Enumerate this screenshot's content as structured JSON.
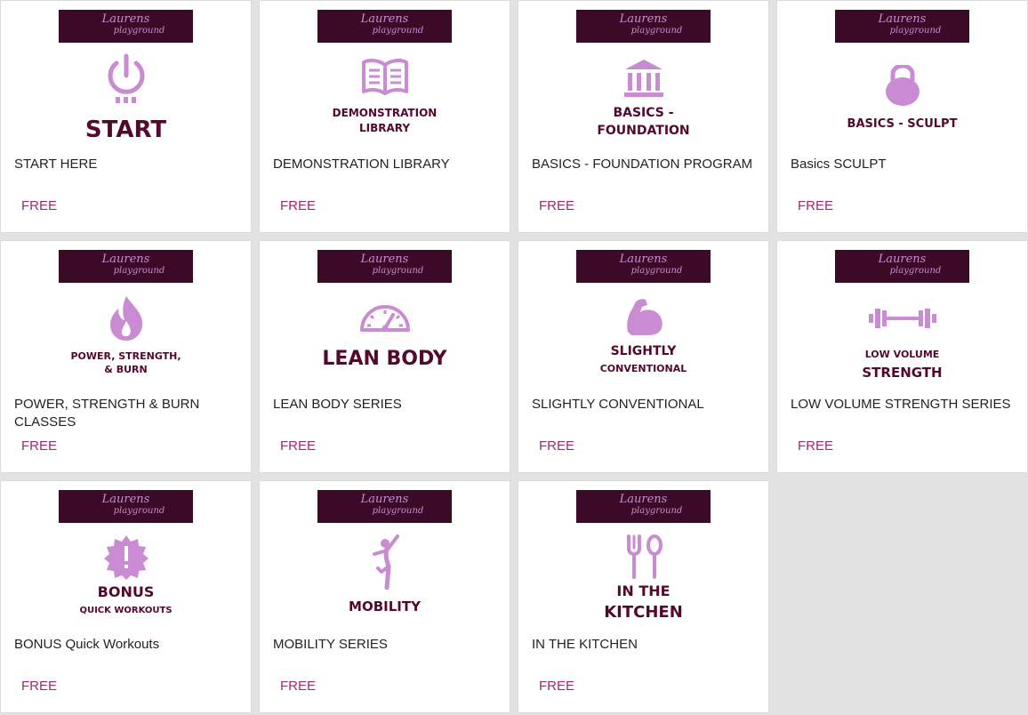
{
  "brand": {
    "line1": "Laurens",
    "line2": "playground"
  },
  "colors": {
    "banner": "#3a0a26",
    "icon": "#c98bd1",
    "icon_text": "#54082e",
    "price": "#a12a6e"
  },
  "courses": [
    {
      "icon": "power-icon",
      "thumb_line1": "START",
      "thumb_line2": "",
      "title": "START HERE",
      "price": "FREE"
    },
    {
      "icon": "book-icon",
      "thumb_line1": "DEMONSTRATION",
      "thumb_line2": "LIBRARY",
      "title": "DEMONSTRATION LIBRARY",
      "price": "FREE"
    },
    {
      "icon": "bank-icon",
      "thumb_line1": "BASICS -",
      "thumb_line2": "FOUNDATION",
      "title": "BASICS - FOUNDATION PROGRAM",
      "price": "FREE"
    },
    {
      "icon": "kettlebell-icon",
      "thumb_line1": "BASICS - SCULPT",
      "thumb_line2": "",
      "title": "Basics SCULPT",
      "price": "FREE"
    },
    {
      "icon": "flame-icon",
      "thumb_line1": "POWER, STRENGTH,",
      "thumb_line2": "& BURN",
      "title": "POWER, STRENGTH & BURN CLASSES",
      "price": "FREE"
    },
    {
      "icon": "speedometer-icon",
      "thumb_line1": "LEAN BODY",
      "thumb_line2": "",
      "title": "LEAN BODY SERIES",
      "price": "FREE"
    },
    {
      "icon": "flexed-arm-icon",
      "thumb_line1": "SLIGHTLY",
      "thumb_line2": "CONVENTIONAL",
      "title": "SLIGHTLY CONVENTIONAL",
      "price": "FREE"
    },
    {
      "icon": "dumbbell-icon",
      "thumb_line1": "LOW VOLUME",
      "thumb_line2": "STRENGTH",
      "title": "LOW VOLUME STRENGTH SERIES",
      "price": "FREE"
    },
    {
      "icon": "alert-badge-icon",
      "thumb_line1": "BONUS",
      "thumb_line2": "QUICK WORKOUTS",
      "title": "BONUS Quick Workouts",
      "price": "FREE"
    },
    {
      "icon": "yoga-pose-icon",
      "thumb_line1": "MOBILITY",
      "thumb_line2": "",
      "title": "MOBILITY SERIES",
      "price": "FREE"
    },
    {
      "icon": "fork-spoon-icon",
      "thumb_line1": "IN THE",
      "thumb_line2": "KITCHEN",
      "title": "IN THE KITCHEN",
      "price": "FREE"
    }
  ]
}
